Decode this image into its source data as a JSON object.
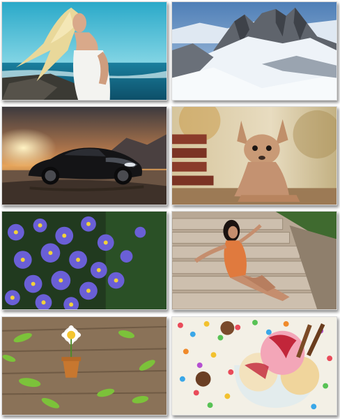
{
  "gallery": {
    "tiles": [
      {
        "subject": "woman-at-sea-photo"
      },
      {
        "subject": "snowy-mountains-photo"
      },
      {
        "subject": "black-sports-car-sunset-photo"
      },
      {
        "subject": "small-dog-on-bench-photo"
      },
      {
        "subject": "purple-flowers-photo"
      },
      {
        "subject": "woman-on-stone-steps-photo"
      },
      {
        "subject": "daisy-pot-on-wood-photo"
      },
      {
        "subject": "ice-cream-and-candies-photo"
      }
    ]
  }
}
